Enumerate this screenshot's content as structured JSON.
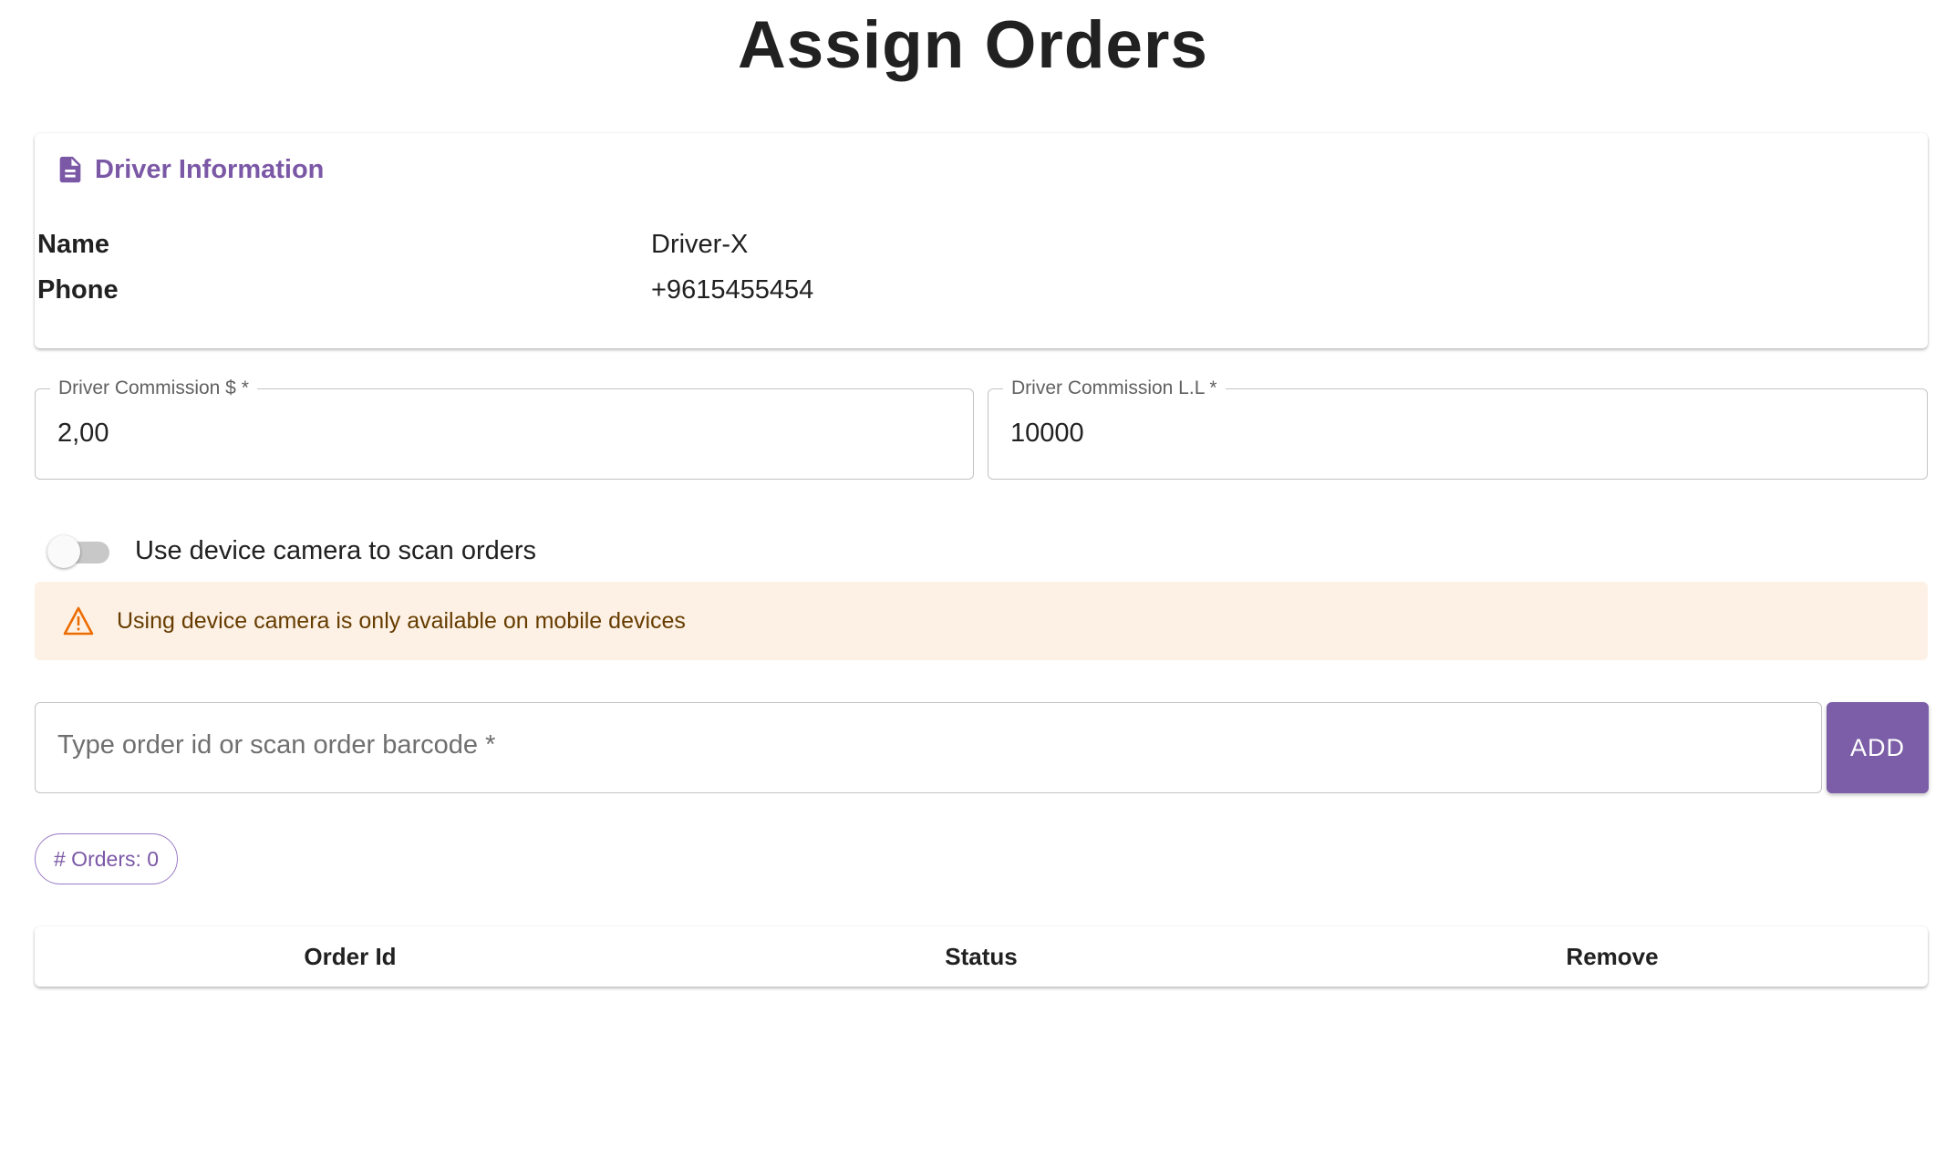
{
  "page": {
    "title": "Assign Orders"
  },
  "driver_info": {
    "title": "Driver Information",
    "icon": "document-icon",
    "name_label": "Name",
    "name_value": "Driver-X",
    "phone_label": "Phone",
    "phone_value": "+9615455454"
  },
  "commission": {
    "usd_label": "Driver Commission $ *",
    "usd_value": "2,00",
    "ll_label": "Driver Commission L.L *",
    "ll_value": "10000"
  },
  "camera_toggle": {
    "label": "Use device camera to scan orders",
    "checked": false
  },
  "alert": {
    "icon": "warning-icon",
    "text": "Using device camera is only available on mobile devices"
  },
  "order_input": {
    "placeholder": "Type order id or scan order barcode *",
    "value": "",
    "add_label": "ADD"
  },
  "orders_chip": {
    "text": "# Orders: 0"
  },
  "table": {
    "columns": [
      "Order Id",
      "Status",
      "Remove"
    ],
    "rows": []
  },
  "colors": {
    "accent": "#7b58a6",
    "button": "#7b5ea7",
    "alert_bg": "#fdf1e5",
    "alert_icon": "#ed6c02",
    "alert_text": "#663c00"
  }
}
